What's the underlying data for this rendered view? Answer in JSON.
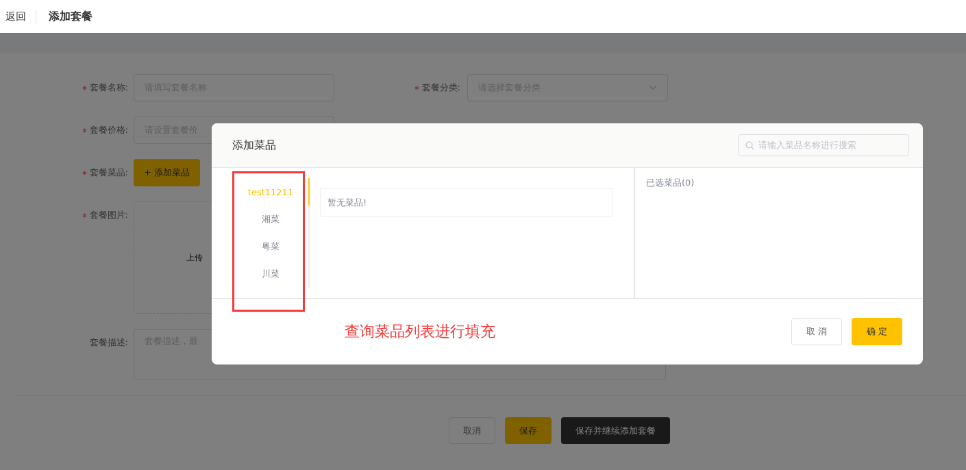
{
  "header": {
    "back": "返回",
    "title": "添加套餐"
  },
  "form": {
    "rows": [
      {
        "fields": [
          {
            "label": "套餐名称:",
            "required": true,
            "kind": "input",
            "placeholder": "请填写套餐名称"
          },
          {
            "label": "套餐分类:",
            "required": true,
            "kind": "select",
            "placeholder": "请选择套餐分类"
          }
        ]
      },
      {
        "fields": [
          {
            "label": "套餐价格:",
            "required": true,
            "kind": "input",
            "placeholder": "请设置套餐价"
          }
        ]
      },
      {
        "fields": [
          {
            "label": "套餐菜品:",
            "required": true,
            "kind": "add",
            "text": "+ 添加菜品"
          }
        ]
      },
      {
        "fields": [
          {
            "label": "套餐图片:",
            "required": true,
            "kind": "upload",
            "text": "上传"
          }
        ]
      },
      {
        "fields": [
          {
            "label": "套餐描述:",
            "required": false,
            "kind": "textarea",
            "placeholder": "套餐描述，最"
          }
        ]
      }
    ],
    "buttons": [
      {
        "text": "取消",
        "kind": "plain"
      },
      {
        "text": "保存",
        "kind": "primary"
      },
      {
        "text": "保存并继续添加套餐",
        "kind": "dark"
      }
    ]
  },
  "dialog": {
    "title": "添加菜品",
    "search": {
      "placeholder": "请输入菜品名称进行搜索"
    },
    "categories": [
      {
        "label": "test11211",
        "selected": true
      },
      {
        "label": "湘菜",
        "selected": false
      },
      {
        "label": "粤菜",
        "selected": false
      },
      {
        "label": "川菜",
        "selected": false
      }
    ],
    "empty_text": "暂无菜品!",
    "selected_title": "已选菜品(0)",
    "buttons": [
      {
        "text": "取 消",
        "kind": "plain"
      },
      {
        "text": "确 定",
        "kind": "primary"
      }
    ]
  },
  "annotation": {
    "text": "查询菜品列表进行填充"
  }
}
